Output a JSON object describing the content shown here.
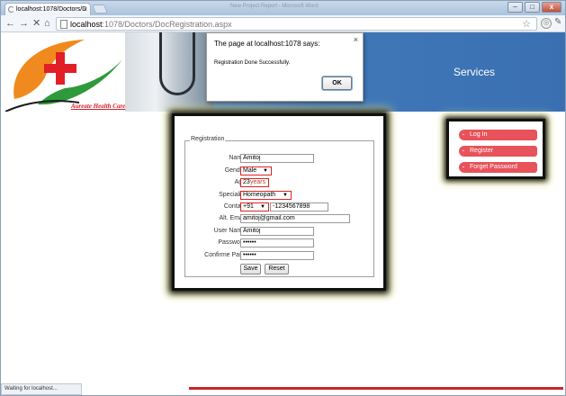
{
  "browser": {
    "tab_title": "localhost:1078/Doctors/D",
    "tab_close": "×",
    "window_title": "New Project Report - Microsoft Word",
    "url_host": "localhost",
    "url_path": ":1078/Doctors/DocRegistration.aspx",
    "status_text": "Waiting for localhost...",
    "controls": {
      "minimize": "–",
      "maximize": "□",
      "close": "x"
    },
    "nav": {
      "back": "←",
      "forward": "→",
      "stop": "✕",
      "home": "⌂"
    },
    "star": "☆",
    "wrench": "🔧"
  },
  "header": {
    "brand": "Aureate Health Care",
    "services": "Services"
  },
  "alert": {
    "title": "The page at localhost:1078 says:",
    "close": "×",
    "message": "Registration Done Successfully.",
    "ok_label": "OK"
  },
  "registration": {
    "legend": "Registration",
    "name_label": "Name:",
    "name_value": "Amitoj",
    "gender_label": "Gender:",
    "gender_value": "Male",
    "age_label": "Age:",
    "age_value": "23",
    "age_unit": "years",
    "speciality_label": "Speciality:",
    "speciality_value": "Homeopath",
    "contact_label": "Contact:",
    "contact_code": "+91",
    "contact_number": "-1234567898",
    "alt_email_label": "Alt. Email:",
    "alt_email_value": "amitoj@gmail.com",
    "username_label": "User Name:",
    "username_value": "Amitoj",
    "password_label": "Password:",
    "password_value": "••••••",
    "confirm_label": "Confirme Pass:",
    "confirm_value": "••••••",
    "save_label": "Save",
    "reset_label": "Reset"
  },
  "side_menu": {
    "items": [
      {
        "label": "Log In"
      },
      {
        "label": "Register"
      },
      {
        "label": "Forget Password"
      }
    ]
  },
  "colors": {
    "banner_blue": "#3f78b8",
    "menu_red": "#e8525a",
    "brand_red": "#d0202c"
  }
}
